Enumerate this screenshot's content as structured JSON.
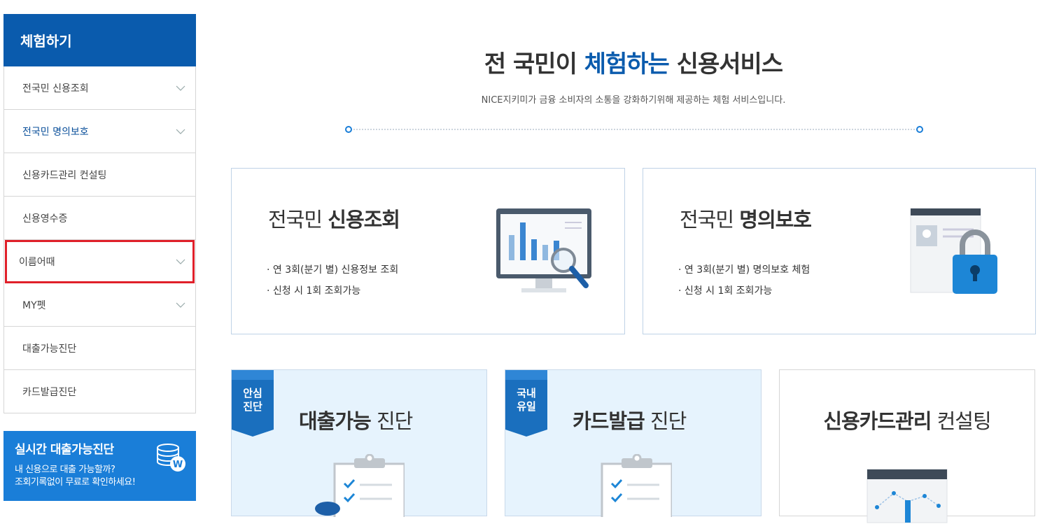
{
  "sidebar": {
    "title": "체험하기",
    "items": [
      {
        "label": "전국민 신용조회",
        "chevron": true
      },
      {
        "label": "전국민 명의보호",
        "chevron": true
      },
      {
        "label": "신용카드관리 컨설팅",
        "chevron": false
      },
      {
        "label": "신용영수증",
        "chevron": false
      },
      {
        "label": "이름어때",
        "chevron": true
      },
      {
        "label": "MY펫",
        "chevron": true
      },
      {
        "label": "대출가능진단",
        "chevron": false
      },
      {
        "label": "카드발급진단",
        "chevron": false
      }
    ],
    "banner": {
      "title": "실시간 대출가능진단",
      "line1": "내 신용으로 대출 가능할까?",
      "line2": "조회기록없이 무료로 확인하세요!"
    }
  },
  "hero": {
    "title_pre": "전 국민이 ",
    "title_accent": "체험하는",
    "title_post": " 신용서비스",
    "subtitle": "NICE지키미가 금융 소비자의 소통을 강화하기위해 제공하는 체험 서비스입니다."
  },
  "cards": [
    {
      "title_light": "전국민 ",
      "title_bold": "신용조회",
      "bullets": [
        "· 연 3회(분기 별) 신용정보 조회",
        "· 신청 시 1회 조회가능"
      ]
    },
    {
      "title_light": "전국민 ",
      "title_bold": "명의보호",
      "bullets": [
        "· 연 3회(분기 별) 명의보호 체험",
        "· 신청 시 1회 조회가능"
      ]
    }
  ],
  "bottom_cards": [
    {
      "ribbon": [
        "안심",
        "진단"
      ],
      "title_bold": "대출가능",
      "title_light": " 진단"
    },
    {
      "ribbon": [
        "국내",
        "유일"
      ],
      "title_bold": "카드발급",
      "title_light": " 진단"
    },
    {
      "title_bold": "신용카드관리",
      "title_light": " 컨설팅"
    }
  ],
  "colors": {
    "brand": "#0a5bad",
    "highlight": "#e0202a",
    "banner": "#1a7ed8"
  }
}
